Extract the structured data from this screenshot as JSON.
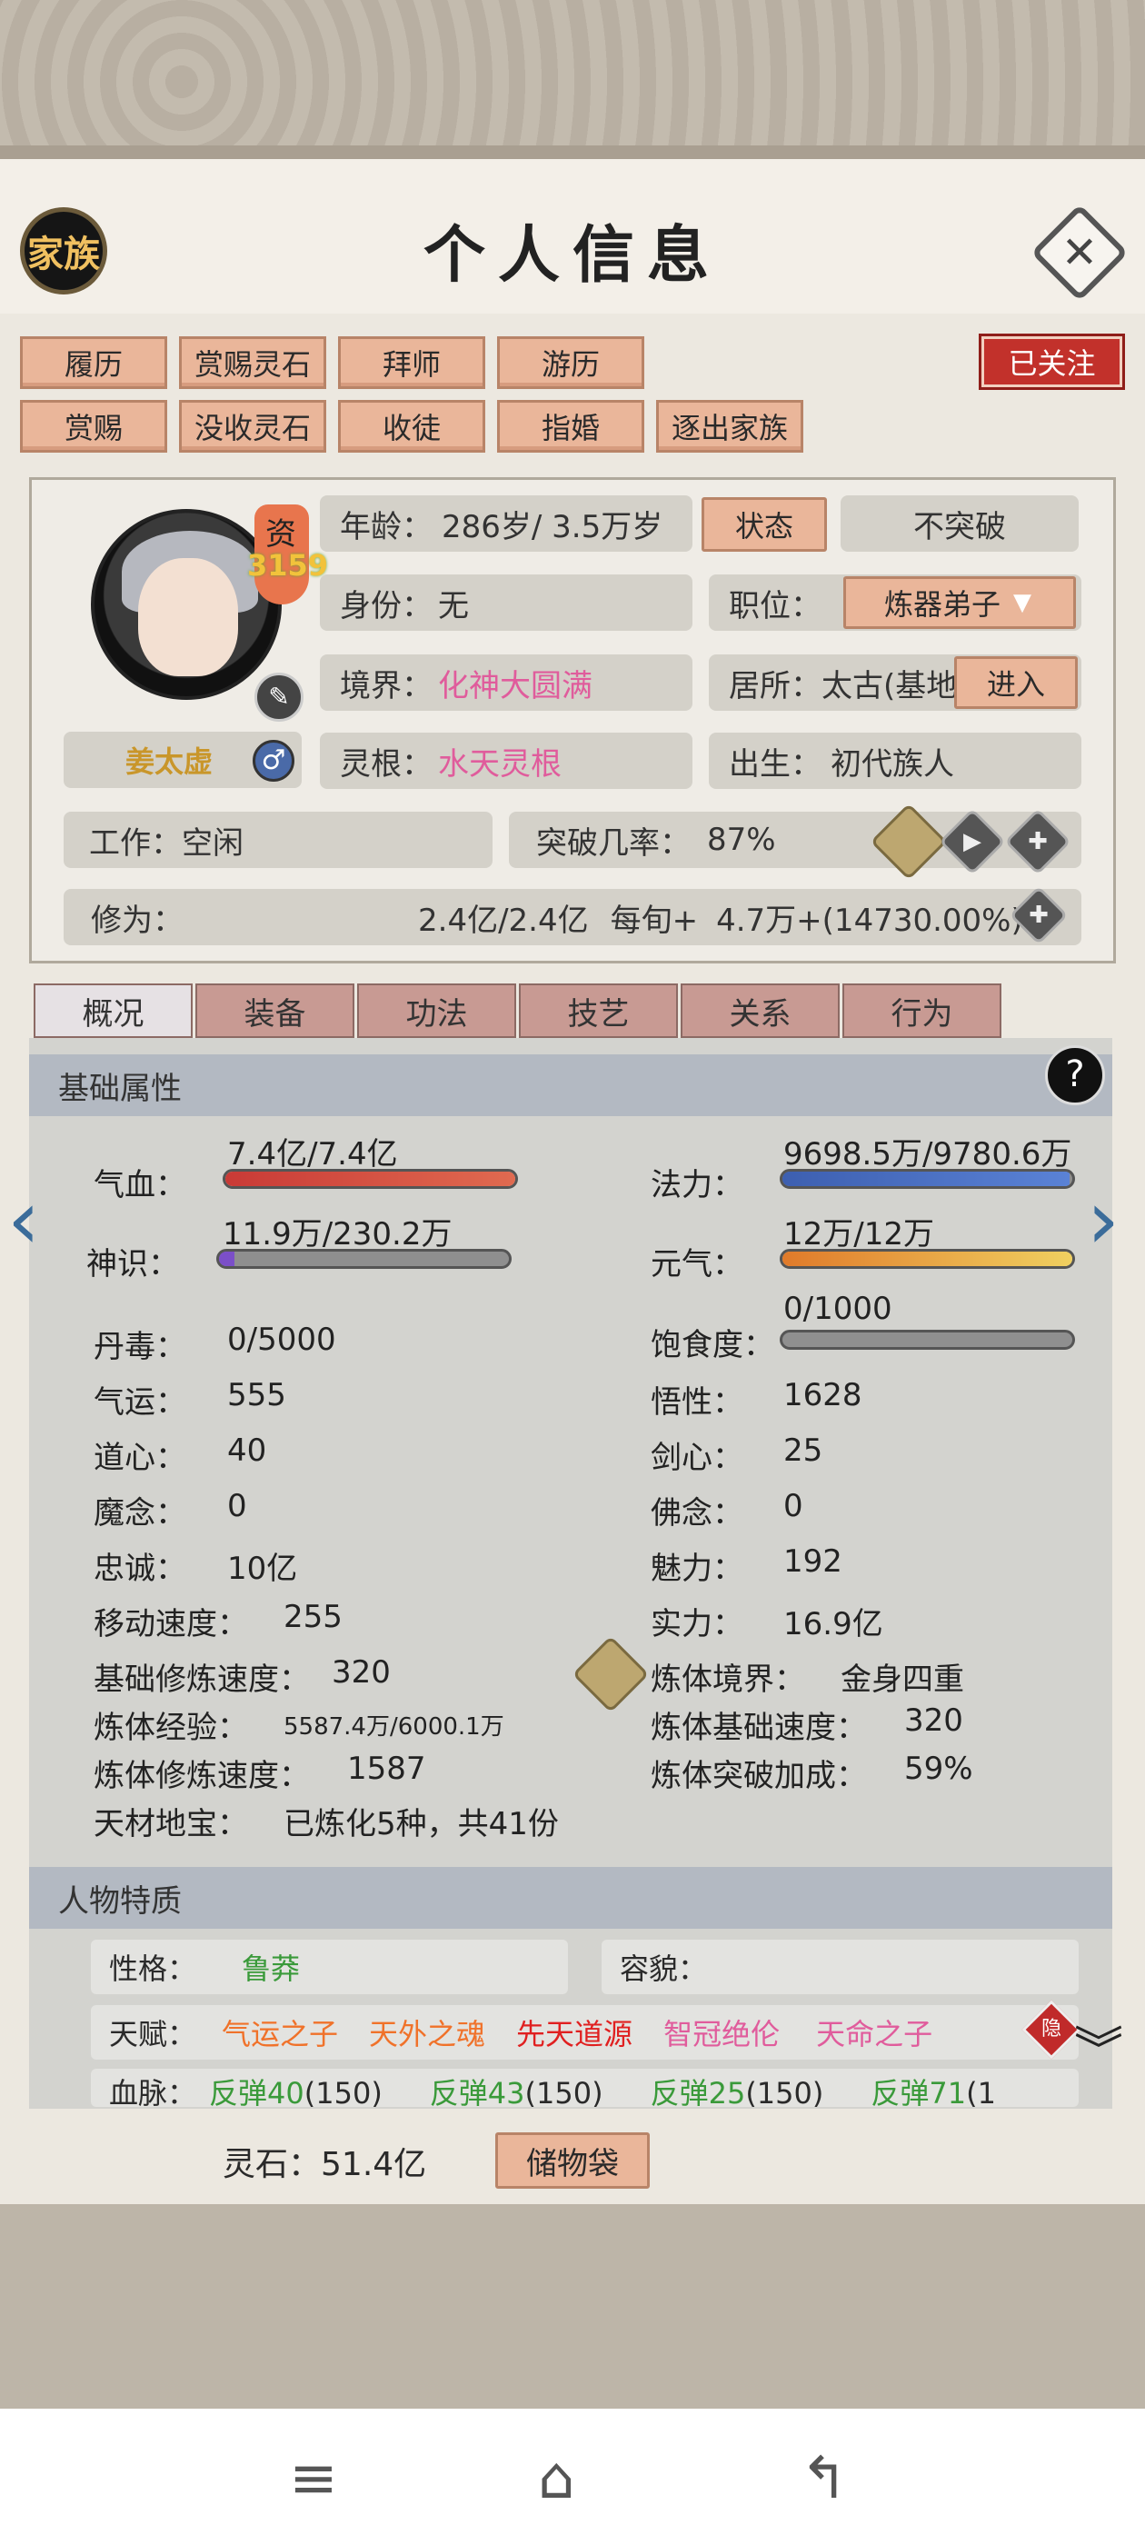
{
  "header": {
    "family_label": "家族",
    "title": "个人信息",
    "close_icon": "close-icon"
  },
  "actions": {
    "row1": [
      "履历",
      "赏赐灵石",
      "拜师",
      "游历"
    ],
    "row2": [
      "赏赐",
      "没收灵石",
      "收徒",
      "指婚",
      "逐出家族"
    ],
    "follow": "已关注"
  },
  "character": {
    "name": "姜太虚",
    "aptitude_label": "资",
    "aptitude_value": "3159",
    "age_label": "年龄：",
    "age_value": "286岁/ 3.5万岁",
    "status_button": "状态",
    "no_breakthrough": "不突破",
    "identity_label": "身份：",
    "identity_value": "无",
    "position_label": "职位：",
    "position_value": "炼器弟子",
    "realm_label": "境界：",
    "realm_value": "化神大圆满",
    "residence_label": "居所：",
    "residence_value": "太古(基地",
    "enter_button": "进入",
    "root_label": "灵根：",
    "root_value": "水天灵根",
    "birth_label": "出生：",
    "birth_value": "初代族人",
    "work_label": "工作：",
    "work_value": "空闲",
    "break_rate_label": "突破几率：",
    "break_rate_value": "87%",
    "cultivation_label": "修为：",
    "cultivation_value": "2.4亿/2.4亿",
    "per_turn_label": "每旬+",
    "per_turn_value": "4.7万+(14730.00%)"
  },
  "tabs": [
    "概况",
    "装备",
    "功法",
    "技艺",
    "关系",
    "行为"
  ],
  "basic": {
    "title": "基础属性",
    "hp_label": "气血：",
    "hp_value": "7.4亿/7.4亿",
    "hp_ratio": 1.0,
    "mana_label": "法力：",
    "mana_value": "9698.5万/9780.6万",
    "mana_ratio": 0.99,
    "sense_label": "神识：",
    "sense_value": "11.9万/230.2万",
    "sense_ratio": 0.052,
    "yuanqi_label": "元气：",
    "yuanqi_value": "12万/12万",
    "yuanqi_ratio": 1.0,
    "satiety_label": "饱食度：",
    "satiety_value": "0/1000",
    "satiety_ratio": 0.0,
    "rows_left": [
      {
        "label": "丹毒：",
        "value": "0/5000"
      },
      {
        "label": "气运：",
        "value": "555"
      },
      {
        "label": "道心：",
        "value": "40"
      },
      {
        "label": "魔念：",
        "value": "0"
      },
      {
        "label": "忠诚：",
        "value": "10亿"
      },
      {
        "label": "移动速度：",
        "value": "255"
      }
    ],
    "rows_right": [
      {
        "label": "悟性：",
        "value": "1628"
      },
      {
        "label": "剑心：",
        "value": "25"
      },
      {
        "label": "佛念：",
        "value": "0"
      },
      {
        "label": "魅力：",
        "value": "192"
      },
      {
        "label": "实力：",
        "value": "16.9亿"
      }
    ],
    "base_speed_label": "基础修炼速度：",
    "base_speed_value": "320",
    "body_exp_label": "炼体经验：",
    "body_exp_value": "5587.4万/6000.1万",
    "body_speed_label": "炼体修炼速度：",
    "body_speed_value": "1587",
    "treasure_label": "天材地宝：",
    "treasure_value": "已炼化5种，共41份",
    "body_realm_label": "炼体境界：",
    "body_realm_value": "金身四重",
    "body_base_speed_label": "炼体基础速度：",
    "body_base_speed_value": "320",
    "body_break_label": "炼体突破加成：",
    "body_break_value": "59%"
  },
  "traits": {
    "title": "人物特质",
    "personality_label": "性格：",
    "personality_value": "鲁莽",
    "looks_label": "容貌：",
    "talent_label": "天赋：",
    "talents": [
      "气运之子",
      "天外之魂",
      "先天道源",
      "智冠绝伦",
      "天命之子"
    ],
    "hide_label": "隐",
    "blood_label": "血脉：",
    "blood_items": [
      "反弹40(150)",
      "反弹43(150)",
      "反弹25(150)",
      "反弹71(1"
    ]
  },
  "footer": {
    "stone_label": "灵石：",
    "stone_value": "51.4亿",
    "bag_button": "储物袋"
  },
  "colors": {
    "hp": "#d9453a",
    "mana": "#3d5fb0",
    "sense": "#7b4fc8",
    "yuanqi": "#e07a2a",
    "accent": "#eab69a"
  }
}
